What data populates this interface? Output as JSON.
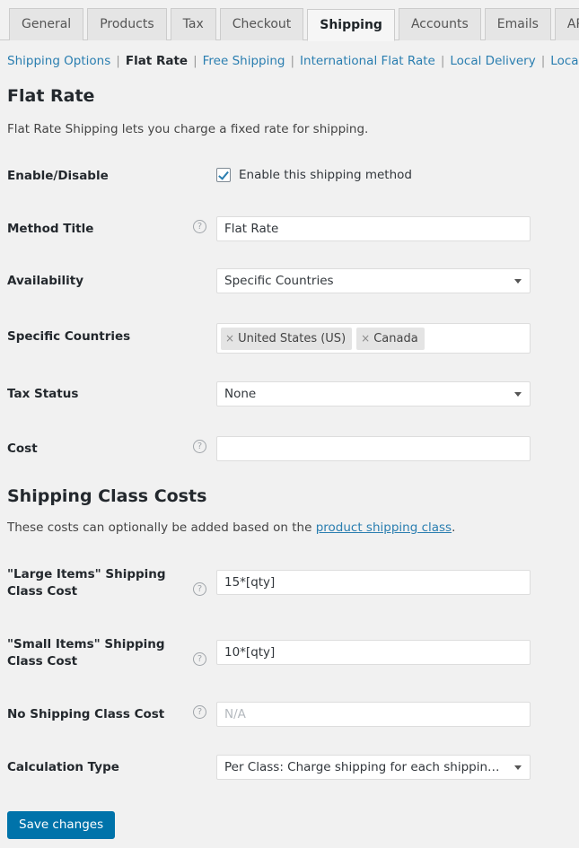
{
  "tabs": [
    {
      "label": "General",
      "active": false
    },
    {
      "label": "Products",
      "active": false
    },
    {
      "label": "Tax",
      "active": false
    },
    {
      "label": "Checkout",
      "active": false
    },
    {
      "label": "Shipping",
      "active": true
    },
    {
      "label": "Accounts",
      "active": false
    },
    {
      "label": "Emails",
      "active": false
    },
    {
      "label": "API",
      "active": false
    }
  ],
  "subnav": {
    "separator": "|",
    "items": [
      {
        "label": "Shipping Options",
        "current": false
      },
      {
        "label": "Flat Rate",
        "current": true
      },
      {
        "label": "Free Shipping",
        "current": false
      },
      {
        "label": "International Flat Rate",
        "current": false
      },
      {
        "label": "Local Delivery",
        "current": false
      },
      {
        "label": "Local Pickup",
        "current": false
      }
    ]
  },
  "page": {
    "heading": "Flat Rate",
    "description": "Flat Rate Shipping lets you charge a fixed rate for shipping."
  },
  "fields": {
    "enable": {
      "label": "Enable/Disable",
      "checkbox_label": "Enable this shipping method",
      "checked": true
    },
    "method_title": {
      "label": "Method Title",
      "help": "?",
      "value": "Flat Rate"
    },
    "availability": {
      "label": "Availability",
      "value": "Specific Countries"
    },
    "specific_countries": {
      "label": "Specific Countries",
      "remove_glyph": "×",
      "tokens": [
        "United States (US)",
        "Canada"
      ]
    },
    "tax_status": {
      "label": "Tax Status",
      "value": "None"
    },
    "cost": {
      "label": "Cost",
      "help": "?",
      "value": ""
    }
  },
  "class_section": {
    "heading": "Shipping Class Costs",
    "description_before": "These costs can optionally be added based on the ",
    "description_link": "product shipping class",
    "description_after": ".",
    "large_items": {
      "label": "\"Large Items\" Shipping Class Cost",
      "help": "?",
      "value": "15*[qty]"
    },
    "small_items": {
      "label": "\"Small Items\" Shipping Class Cost",
      "help": "?",
      "value": "10*[qty]"
    },
    "no_class": {
      "label": "No Shipping Class Cost",
      "help": "?",
      "value": "",
      "placeholder": "N/A"
    },
    "calculation_type": {
      "label": "Calculation Type",
      "value": "Per Class: Charge shipping for each shipping cl..."
    }
  },
  "footer": {
    "save_label": "Save changes"
  },
  "colors": {
    "accent": "#0073aa",
    "link": "#2a7eb0",
    "background": "#f1f1f1",
    "checkmark": "#2a7eb0"
  }
}
